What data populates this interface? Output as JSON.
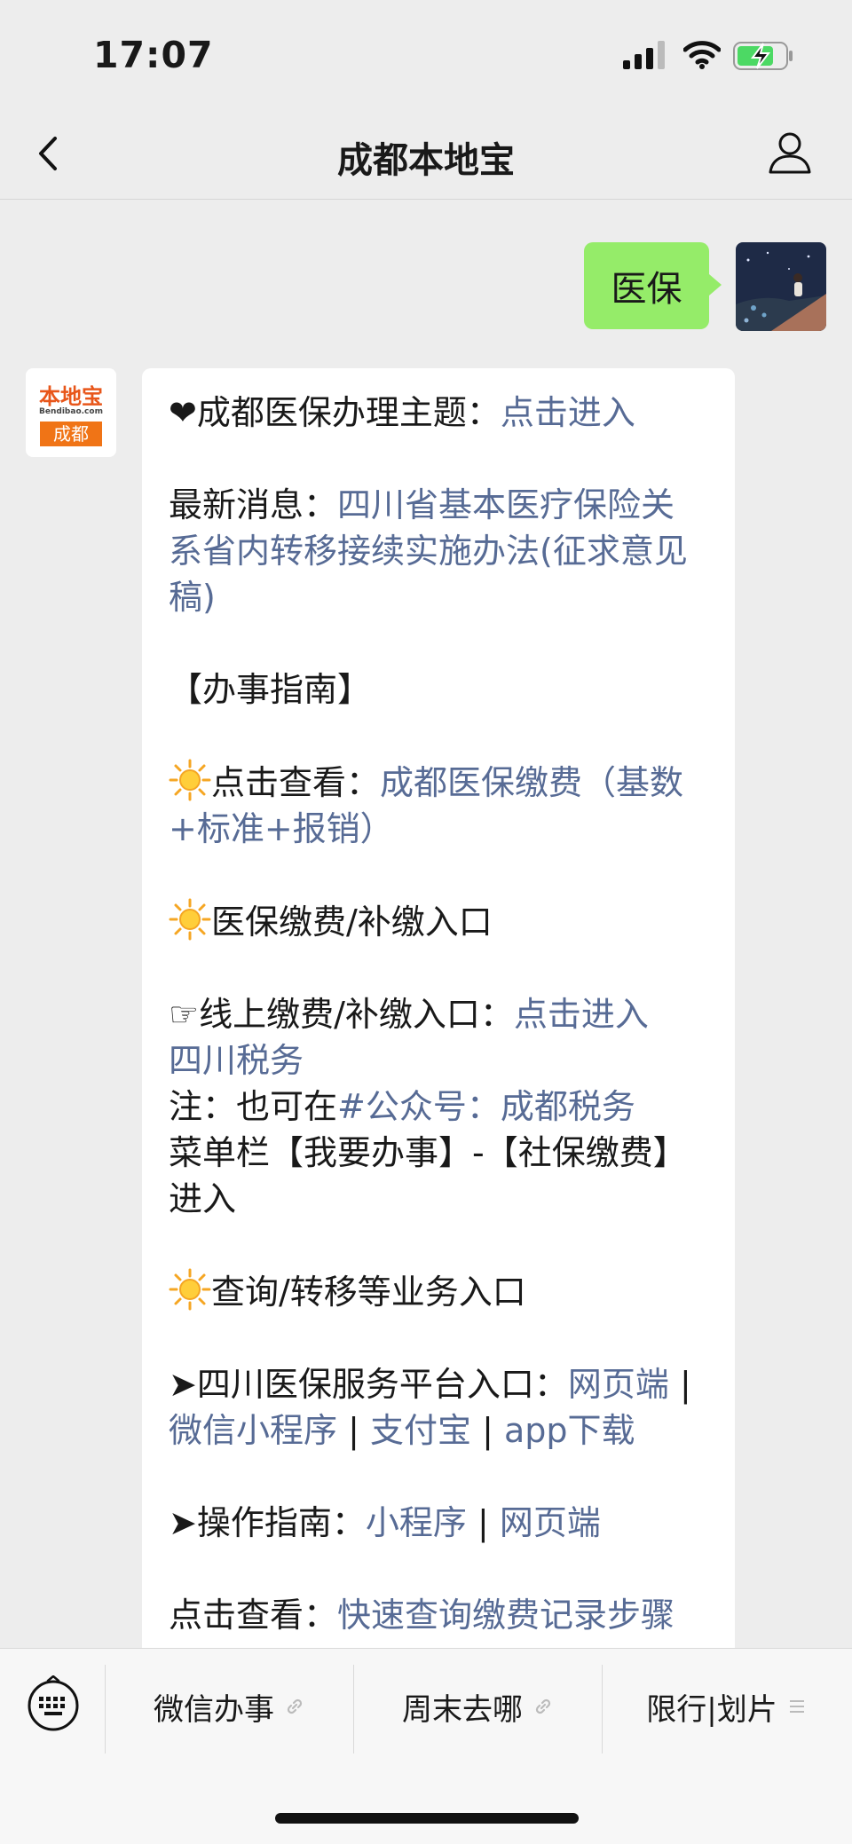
{
  "status_bar": {
    "time": "17:07"
  },
  "nav": {
    "title": "成都本地宝"
  },
  "user_message": {
    "text": "医保"
  },
  "bot": {
    "logo_top": "本地宝",
    "logo_mid": "Bendibao.com",
    "logo_bottom": "成都",
    "p1_label": "❤成都医保办理主题：",
    "p1_link": "点击进入",
    "p2_label": "最新消息：",
    "p2_link": "四川省基本医疗保险关系省内转移接续实施办法(征求意见稿)",
    "p3": "【办事指南】",
    "p4_label": "点击查看：",
    "p4_link": "成都医保缴费（基数+标准+报销）",
    "p5": "医保缴费/补缴入口",
    "p6_label": "☞线上缴费/补缴入口：",
    "p6_link1": "点击进入",
    "p6_link2": "四川税务",
    "p6_note_label": "注：也可在",
    "p6_note_link": "#公众号：成都税务",
    "p6_note_rest": "菜单栏【我要办事】-【社保缴费】进入",
    "p7": "查询/转移等业务入口",
    "p8_label": "➤四川医保服务平台入口：",
    "p8_link1": "网页端",
    "sep1": " | ",
    "p8_link2": "微信小程序",
    "sep2": " | ",
    "p8_link3": "支付宝",
    "sep3": " | ",
    "p8_link4": "app下载",
    "p9_label": "➤操作指南：",
    "p9_link1": "小程序",
    "sep4": " | ",
    "p9_link2": "网页端",
    "p10_label": "点击查看：",
    "p10_link": "快速查询缴费记录步骤"
  },
  "bottom_menu": {
    "item1": "微信办事",
    "item2": "周末去哪",
    "item3": "限行|划片"
  },
  "colors": {
    "link": "#576b95",
    "user_bubble": "#95ec69",
    "brand_orange": "#f07416"
  }
}
